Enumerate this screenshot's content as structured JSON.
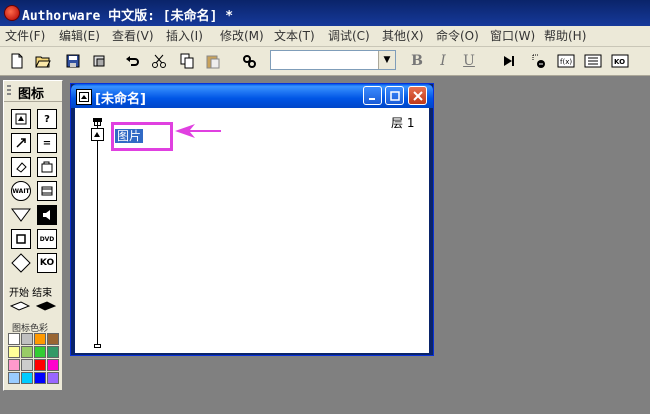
{
  "app": {
    "title": "Authorware 中文版: [未命名] *"
  },
  "menu": {
    "items": [
      {
        "label": "文件(F)"
      },
      {
        "label": "编辑(E)"
      },
      {
        "label": "查看(V)"
      },
      {
        "label": "插入(I)"
      },
      {
        "label": "修改(M)"
      },
      {
        "label": "文本(T)"
      },
      {
        "label": "调试(C)"
      },
      {
        "label": "其他(X)"
      },
      {
        "label": "命令(O)"
      },
      {
        "label": "窗口(W)"
      },
      {
        "label": "帮助(H)"
      }
    ]
  },
  "toolbar": {
    "font_value": "",
    "bold_label": "B",
    "italic_label": "I",
    "underline_label": "U"
  },
  "palette": {
    "title": "图标",
    "flags_label": "开始 结束",
    "colors_label": "图标色彩",
    "wait_label": "WAIT",
    "colors": [
      "#ffffff",
      "#c0c0c0",
      "#ff9900",
      "#996633",
      "#ffff99",
      "#99cc66",
      "#33cc33",
      "#339966",
      "#ff99cc",
      "#cccccc",
      "#ff0000",
      "#ff00cc",
      "#99ccff",
      "#00ccff",
      "#0000ff",
      "#9966ff"
    ]
  },
  "flow_window": {
    "title": "[未命名]",
    "level_label": "层 1",
    "icon_name": "图片"
  },
  "colors": {
    "highlight": "#e040e0",
    "selection": "#316ac5"
  }
}
